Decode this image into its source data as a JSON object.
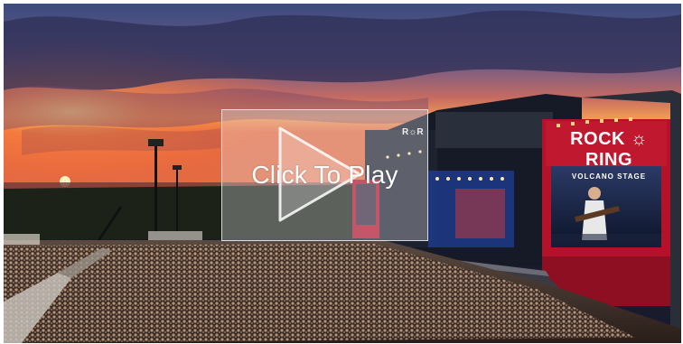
{
  "player": {
    "overlay_label": "Click To Play",
    "play_icon": "play-triangle-icon"
  },
  "stage": {
    "logo": "ROCK ☼ RING",
    "stage_name": "VOLCANO STAGE"
  },
  "colors": {
    "stage_red": "#b3122a",
    "sunset_orange": "#f28a3c",
    "sky_purple": "#4a4a7e"
  }
}
